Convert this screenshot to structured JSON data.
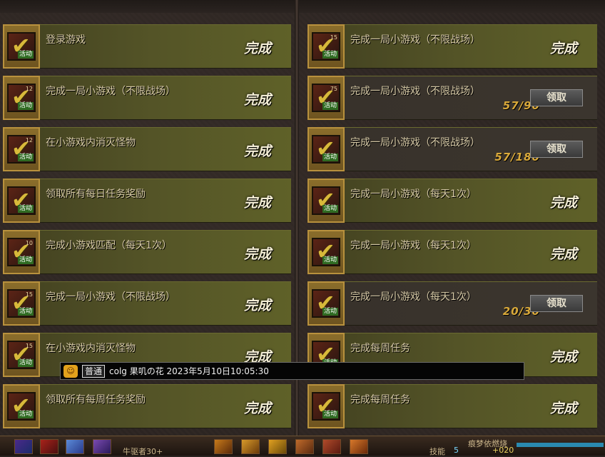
{
  "left_tasks": [
    {
      "name": "登录游戏",
      "status": "完成",
      "icon_level": "",
      "icon_tag": "活动"
    },
    {
      "name": "完成一局小游戏（不限战场）",
      "status": "完成",
      "icon_level": "12",
      "icon_tag": "活动"
    },
    {
      "name": "在小游戏内消灭怪物",
      "status": "完成",
      "icon_level": "12",
      "icon_tag": "活动"
    },
    {
      "name": "领取所有每日任务奖励",
      "status": "完成",
      "icon_level": "",
      "icon_tag": "活动"
    },
    {
      "name": "完成小游戏匹配（每天1次）",
      "status": "完成",
      "icon_level": "10",
      "icon_tag": "活动"
    },
    {
      "name": "完成一局小游戏（不限战场）",
      "status": "完成",
      "icon_level": "15",
      "icon_tag": "活动"
    },
    {
      "name": "在小游戏内消灭怪物",
      "status": "完成",
      "icon_level": "15",
      "icon_tag": "活动"
    },
    {
      "name": "领取所有每周任务奖励",
      "status": "完成",
      "icon_level": "",
      "icon_tag": "活动"
    }
  ],
  "right_tasks": [
    {
      "name": "完成一局小游戏（不限战场）",
      "status": "完成",
      "icon_level": "15",
      "icon_tag": "活动",
      "kind": "done"
    },
    {
      "name": "完成一局小游戏（不限战场）",
      "count": "57/90",
      "button": "领取",
      "icon_level": "75",
      "icon_tag": "活动",
      "kind": "prog"
    },
    {
      "name": "完成一局小游戏（不限战场）",
      "count": "57/180",
      "button": "领取",
      "icon_level": "",
      "icon_tag": "活动",
      "kind": "prog"
    },
    {
      "name": "完成一局小游戏（每天1次）",
      "status": "完成",
      "icon_level": "",
      "icon_tag": "活动",
      "kind": "done"
    },
    {
      "name": "完成一局小游戏（每天1次）",
      "status": "完成",
      "icon_level": "",
      "icon_tag": "活动",
      "kind": "done"
    },
    {
      "name": "完成一局小游戏（每天1次）",
      "count": "20/30",
      "button": "领取",
      "icon_level": "",
      "icon_tag": "活动",
      "kind": "prog"
    },
    {
      "name": "完成每周任务",
      "status": "完成",
      "icon_level": "",
      "icon_tag": "活动",
      "kind": "done"
    },
    {
      "name": "完成每周任务",
      "status": "完成",
      "icon_level": "",
      "icon_tag": "活动",
      "kind": "done"
    }
  ],
  "chat": {
    "emoji": "😀",
    "channel": "普通",
    "message": "colg 果叽の花 2023年5月10日10:05:30"
  },
  "bottom_bar": {
    "left_text": "牛驱者30+",
    "skill_label": "技能",
    "skill_value": "5",
    "right_text": "痕梦依燃烧",
    "gold": "+020"
  }
}
